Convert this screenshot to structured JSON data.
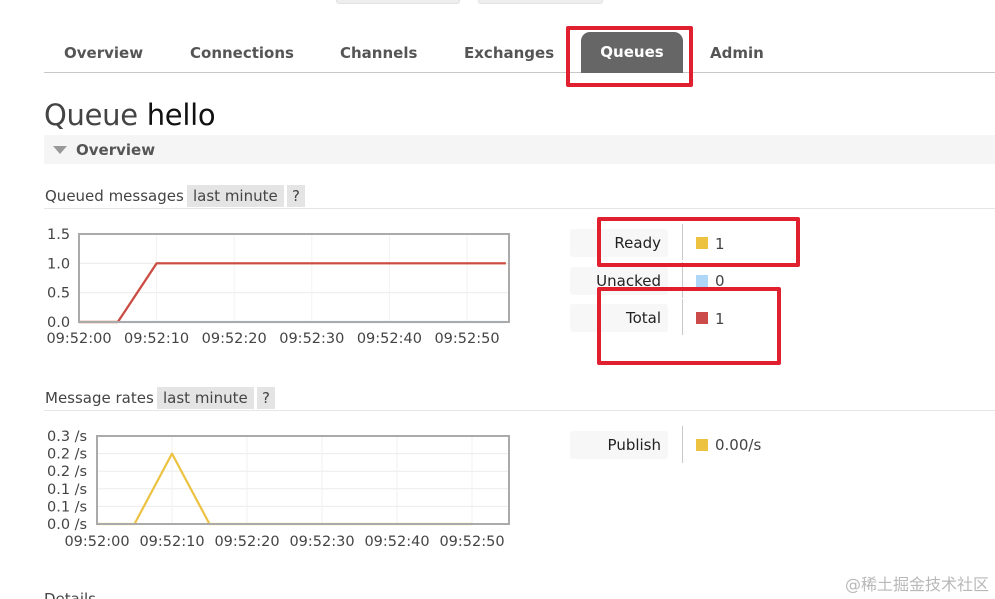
{
  "nav": {
    "tabs": [
      {
        "label": "Overview"
      },
      {
        "label": "Connections"
      },
      {
        "label": "Channels"
      },
      {
        "label": "Exchanges"
      },
      {
        "label": "Queues",
        "active": true
      },
      {
        "label": "Admin"
      }
    ]
  },
  "page": {
    "title_prefix": "Queue",
    "queue_name": "hello"
  },
  "overview_section": {
    "label": "Overview"
  },
  "queued_messages": {
    "title": "Queued messages",
    "range": "last minute",
    "help": "?",
    "legend": [
      {
        "label": "Ready",
        "value": "1",
        "color": "#edc240"
      },
      {
        "label": "Unacked",
        "value": "0",
        "color": "#afd8f8"
      },
      {
        "label": "Total",
        "value": "1",
        "color": "#cb4b4b"
      }
    ]
  },
  "message_rates": {
    "title": "Message rates",
    "range": "last minute",
    "help": "?",
    "legend": [
      {
        "label": "Publish",
        "value": "0.00/s",
        "color": "#edc240"
      }
    ]
  },
  "details_label": "Details",
  "watermark": "@稀土掘金技术社区",
  "chart_data": [
    {
      "type": "line",
      "x": [
        "09:52:00",
        "09:52:05",
        "09:52:10",
        "09:52:15",
        "09:52:20",
        "09:52:25",
        "09:52:30",
        "09:52:35",
        "09:52:40",
        "09:52:45",
        "09:52:50",
        "09:52:55"
      ],
      "x_ticks": [
        "09:52:00",
        "09:52:10",
        "09:52:20",
        "09:52:30",
        "09:52:40",
        "09:52:50"
      ],
      "y_ticks": [
        "1.5",
        "1.0",
        "0.5",
        "0.0"
      ],
      "ylim": [
        0,
        1.5
      ],
      "series": [
        {
          "name": "Ready",
          "color": "#edc240",
          "values": [
            0,
            0,
            1,
            1,
            1,
            1,
            1,
            1,
            1,
            1,
            1,
            1
          ]
        },
        {
          "name": "Unacked",
          "color": "#afd8f8",
          "values": [
            0,
            0,
            0,
            0,
            0,
            0,
            0,
            0,
            0,
            0,
            0,
            0
          ]
        },
        {
          "name": "Total",
          "color": "#cb4b4b",
          "values": [
            0,
            0,
            1,
            1,
            1,
            1,
            1,
            1,
            1,
            1,
            1,
            1
          ]
        }
      ],
      "grid": true
    },
    {
      "type": "line",
      "x": [
        "09:52:00",
        "09:52:05",
        "09:52:10",
        "09:52:15",
        "09:52:20",
        "09:52:25",
        "09:52:30",
        "09:52:35",
        "09:52:40",
        "09:52:45",
        "09:52:50"
      ],
      "x_ticks": [
        "09:52:00",
        "09:52:10",
        "09:52:20",
        "09:52:30",
        "09:52:40",
        "09:52:50"
      ],
      "y_ticks": [
        "0.3 /s",
        "0.2 /s",
        "0.2 /s",
        "0.1 /s",
        "0.1 /s",
        "0.0 /s"
      ],
      "ylim": [
        0,
        0.25
      ],
      "series": [
        {
          "name": "Publish",
          "color": "#edc240",
          "values": [
            0,
            0,
            0.2,
            0,
            0,
            0,
            0,
            0,
            0,
            0,
            0
          ]
        }
      ],
      "grid": true
    }
  ]
}
